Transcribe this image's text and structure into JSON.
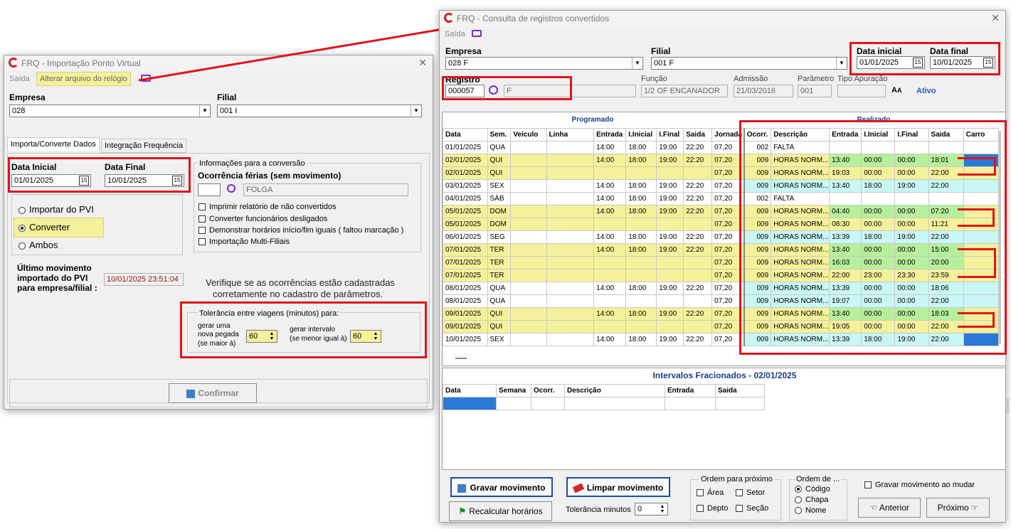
{
  "left": {
    "title": "FRQ - Importação Ponto Virtual",
    "menu_saida": "Saída",
    "menu_alterar": "Alterar arquivo do relógio",
    "empresa_label": "Empresa",
    "empresa_value": "028",
    "filial_label": "Filial",
    "filial_value": "001 I",
    "tab1": "Importa/Converte Dados",
    "tab2": "Integração Frequência",
    "data_inicial_label": "Data Inicial",
    "data_inicial_value": "01/01/2025",
    "data_final_label": "Data Final",
    "data_final_value": "10/01/2025",
    "radio_importar": "Importar do PVI",
    "radio_converter": "Converter",
    "radio_ambos": "Ambos",
    "ultimo_label_1": "Último movimento",
    "ultimo_label_2": "importado do PVI",
    "ultimo_label_3": "para empresa/filial :",
    "ultimo_value": "10/01/2025  23:51:04",
    "info_group": "Informações para a conversão",
    "ocorrencia_label": "Ocorrência férias (sem movimento)",
    "ocorrencia_value": "FOLGA",
    "chk1": "Imprimir relatório de não convertidos",
    "chk2": "Converter funcionários desligados",
    "chk3": "Demonstrar horários início/fim iguais ( faltou marcação )",
    "chk4": "Importação Multi-Filiais",
    "verifique_1": "Verifique se as ocorrências estão cadastradas",
    "verifique_2": "corretamente  no cadastro de parâmetros.",
    "tol_group": "Tolerância entre viagens (minutos) para:",
    "tol_a1": "gerar uma",
    "tol_a2": "nova pegada",
    "tol_a3": "(se maior à)",
    "tol_a_value": "60",
    "tol_b1": "gerar intervalo",
    "tol_b2": "(se menor igual à)",
    "tol_b_value": "60",
    "confirmar": "Confirmar"
  },
  "right": {
    "title": "FRQ - Consulta de registros convertidos",
    "menu_saida": "Saída",
    "empresa_label": "Empresa",
    "empresa_value": "028 F",
    "filial_label": "Filial",
    "filial_value": "001 F",
    "data_inicial_label": "Data inicial",
    "data_inicial_value": "01/01/2025",
    "data_final_label": "Data final",
    "data_final_value": "10/01/2025",
    "registro_label": "Registro",
    "registro_value": "000057",
    "nome_value": "F",
    "funcao_label": "Função",
    "funcao_value": "1/2 OF ENCANADOR",
    "admissao_label": "Admissão",
    "admissao_value": "21/03/2016",
    "parametro_label": "Parâmetro",
    "parametro_value": "001",
    "tipo_label": "Tipo Apuração",
    "ativo": "Ativo",
    "programado": "Programado",
    "realizado": "Realizado",
    "headers": [
      "Data",
      "Sem.",
      "Veículo",
      "Linha",
      "Entrada",
      "I.Inicial",
      "I.Final",
      "Saida",
      "Jornada",
      "Ocorr.",
      "Descrição",
      "Entrada",
      "I.Inicial",
      "I.Final",
      "Saida",
      "Carro"
    ],
    "rows": [
      [
        "01/01/2025",
        "QUA",
        "",
        "",
        "14:00",
        "18:00",
        "19:00",
        "22:20",
        "07,20",
        "002",
        "FALTA",
        "",
        "",
        "",
        "",
        ""
      ],
      [
        "02/01/2025",
        "QUI",
        "",
        "",
        "14:00",
        "18:00",
        "19:00",
        "22:20",
        "07,20",
        "009",
        "HORAS NORM...",
        "13:40",
        "00:00",
        "00:00",
        "18:01",
        ""
      ],
      [
        "02/01/2025",
        "QUI",
        "",
        "",
        "",
        "",
        "",
        "",
        "07,20",
        "009",
        "HORAS NORM...",
        "19:03",
        "00:00",
        "00:00",
        "22:00",
        ""
      ],
      [
        "03/01/2025",
        "SEX",
        "",
        "",
        "14:00",
        "18:00",
        "19:00",
        "22:20",
        "07,20",
        "009",
        "HORAS NORM...",
        "13:40",
        "18:00",
        "19:00",
        "22:00",
        ""
      ],
      [
        "04/01/2025",
        "SÁB",
        "",
        "",
        "14:00",
        "18:00",
        "19:00",
        "22:20",
        "07,20",
        "002",
        "FALTA",
        "",
        "",
        "",
        "",
        ""
      ],
      [
        "05/01/2025",
        "DOM",
        "",
        "",
        "14:00",
        "18:00",
        "19:00",
        "22:20",
        "07,20",
        "009",
        "HORAS NORM...",
        "04:40",
        "00:00",
        "00:00",
        "07:20",
        ""
      ],
      [
        "05/01/2025",
        "DOM",
        "",
        "",
        "",
        "",
        "",
        "",
        "07,20",
        "009",
        "HORAS NORM...",
        "08:30",
        "00:00",
        "00:00",
        "11:21",
        ""
      ],
      [
        "06/01/2025",
        "SEG",
        "",
        "",
        "14:00",
        "18:00",
        "19:00",
        "22:20",
        "07,20",
        "009",
        "HORAS NORM...",
        "13:39",
        "18:00",
        "19:00",
        "22:00",
        ""
      ],
      [
        "07/01/2025",
        "TER",
        "",
        "",
        "14:00",
        "18:00",
        "19:00",
        "22:20",
        "07,20",
        "009",
        "HORAS NORM...",
        "13:40",
        "00:00",
        "00:00",
        "15:00",
        ""
      ],
      [
        "07/01/2025",
        "TER",
        "",
        "",
        "",
        "",
        "",
        "",
        "07,20",
        "009",
        "HORAS NORM...",
        "16:03",
        "00:00",
        "00:00",
        "20:00",
        ""
      ],
      [
        "07/01/2025",
        "TER",
        "",
        "",
        "",
        "",
        "",
        "",
        "07,20",
        "009",
        "HORAS NORM...",
        "22:00",
        "23:00",
        "23:30",
        "23:59",
        ""
      ],
      [
        "08/01/2025",
        "QUA",
        "",
        "",
        "14:00",
        "18:00",
        "19:00",
        "22:20",
        "07,20",
        "009",
        "HORAS NORM...",
        "13:39",
        "00:00",
        "00:00",
        "18:06",
        ""
      ],
      [
        "08/01/2025",
        "QUA",
        "",
        "",
        "",
        "",
        "",
        "",
        "07,20",
        "009",
        "HORAS NORM...",
        "19:07",
        "00:00",
        "00:00",
        "22:00",
        ""
      ],
      [
        "09/01/2025",
        "QUI",
        "",
        "",
        "14:00",
        "18:00",
        "19:00",
        "22:20",
        "07,20",
        "009",
        "HORAS NORM...",
        "13:40",
        "00:00",
        "00:00",
        "18:03",
        ""
      ],
      [
        "09/01/2025",
        "QUI",
        "",
        "",
        "",
        "",
        "",
        "",
        "07,20",
        "009",
        "HORAS NORM...",
        "19:05",
        "00:00",
        "00:00",
        "22:00",
        ""
      ],
      [
        "10/01/2025",
        "SEX",
        "",
        "",
        "14:00",
        "18:00",
        "19:00",
        "22:20",
        "07,20",
        "009",
        "HORAS NORM...",
        "13:39",
        "18:00",
        "19:00",
        "22:00",
        ""
      ]
    ],
    "intervalos_title": "Intervalos Fracionados - 02/01/2025",
    "int_headers": [
      "Data",
      "Semana",
      "Ocorr.",
      "Descrição",
      "Entrada",
      "Saida"
    ],
    "btn_gravar": "Gravar movimento",
    "btn_limpar": "Limpar movimento",
    "btn_recalcular": "Recalcular horários",
    "tolerancia_label": "Tolerância minutos",
    "tolerancia_value": "0",
    "ordem_proximo": "Ordem para próximo",
    "op_area": "Área",
    "op_setor": "Setor",
    "op_depto": "Depto",
    "op_secao": "Seção",
    "ordem_de": "Ordem de ...",
    "od_codigo": "Código",
    "od_chapa": "Chapa",
    "od_nome": "Nome",
    "gravar_ao_mudar": "Gravar movimento ao mudar",
    "btn_anterior": "Anterior",
    "btn_proximo": "Próximo"
  }
}
